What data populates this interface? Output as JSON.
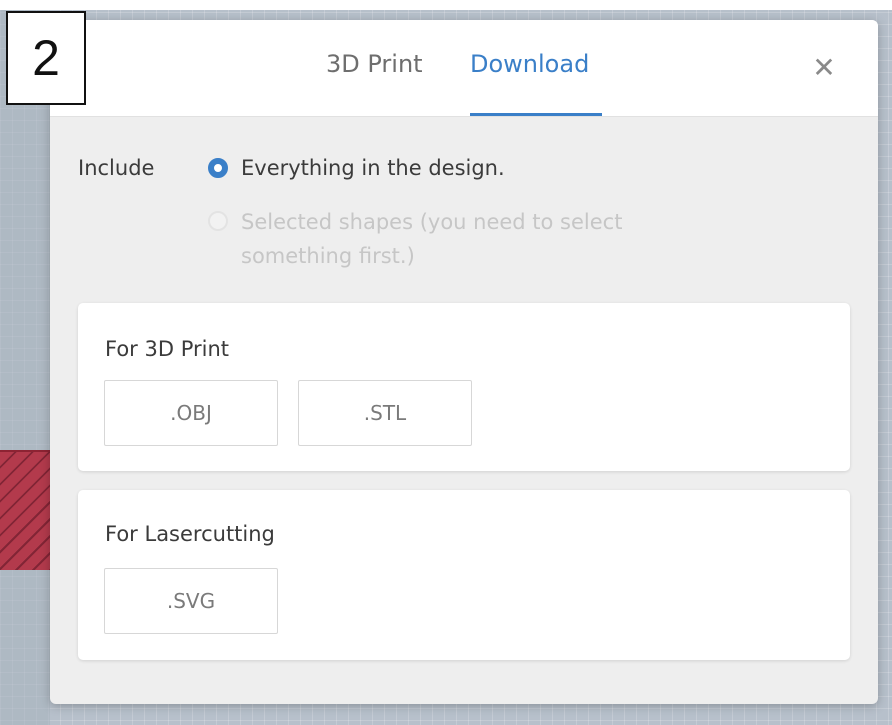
{
  "step_number": "2",
  "tabs": [
    {
      "label": "3D Print",
      "active": false
    },
    {
      "label": "Download",
      "active": true
    }
  ],
  "close_icon": "close-icon",
  "include": {
    "label": "Include",
    "options": [
      {
        "label": "Everything in the design.",
        "selected": true,
        "enabled": true
      },
      {
        "label": "Selected shapes (you need to select something first.)",
        "selected": false,
        "enabled": false
      }
    ]
  },
  "sections": [
    {
      "title": "For 3D Print",
      "buttons": [
        ".OBJ",
        ".STL"
      ]
    },
    {
      "title": "For Lasercutting",
      "buttons": [
        ".SVG"
      ]
    }
  ],
  "colors": {
    "accent": "#3a7fc8",
    "modal_background": "#eeeeee",
    "disabled_text": "#c6c6c6"
  }
}
